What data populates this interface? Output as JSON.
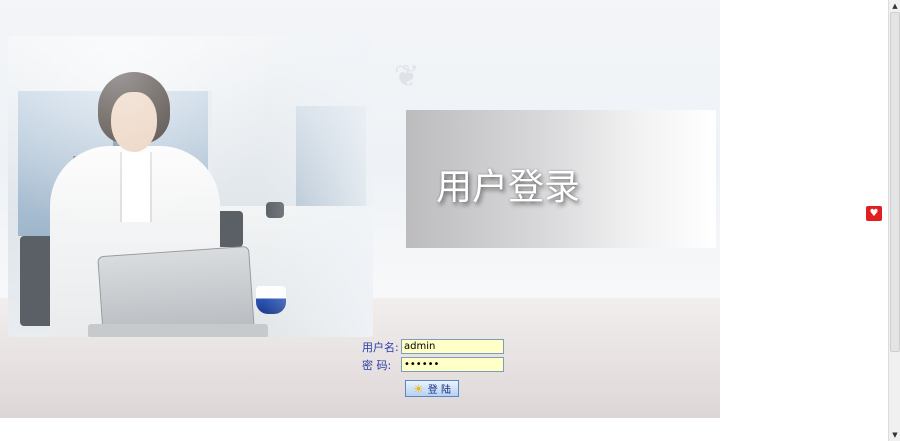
{
  "page": {
    "title": "用户登录"
  },
  "form": {
    "username_label": "用户名:",
    "username_value": "admin",
    "password_label": "密 码:",
    "password_value": "••••••",
    "login_label": "登 陆"
  },
  "icons": {
    "login_button_icon": "sun-icon",
    "floating_badge_icon": "heart-icon"
  },
  "colors": {
    "input_background": "#ffffc8",
    "label_color": "#2a3ea8",
    "badge_color": "#e02020"
  }
}
